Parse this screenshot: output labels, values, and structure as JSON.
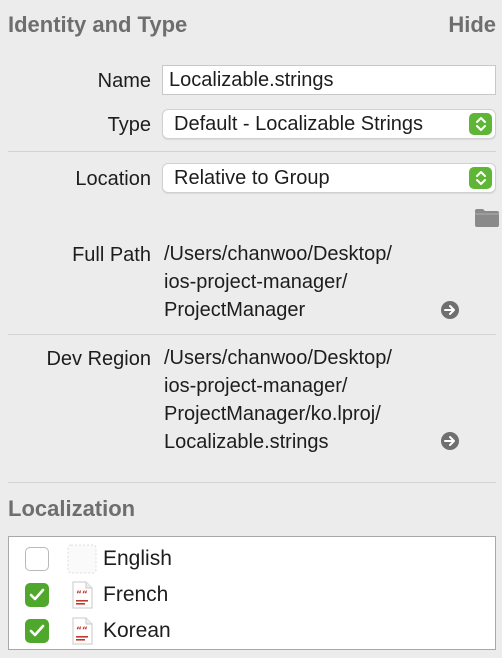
{
  "identity": {
    "title": "Identity and Type",
    "hide_label": "Hide",
    "name_label": "Name",
    "name_value": "Localizable.strings",
    "type_label": "Type",
    "type_value": "Default - Localizable Strings",
    "location_label": "Location",
    "location_value": "Relative to Group",
    "full_path_label": "Full Path",
    "full_path_lines": [
      "/Users/chanwoo/Desktop/",
      "ios-project-manager/",
      "ProjectManager"
    ],
    "dev_region_label": "Dev Region",
    "dev_region_lines": [
      "/Users/chanwoo/Desktop/",
      "ios-project-manager/",
      "ProjectManager/ko.lproj/",
      "Localizable.strings"
    ]
  },
  "localization": {
    "title": "Localization",
    "items": [
      {
        "label": "English",
        "checked": false
      },
      {
        "label": "French",
        "checked": true
      },
      {
        "label": "Korean",
        "checked": true
      }
    ]
  },
  "colors": {
    "accent_green": "#5fb536",
    "header_gray": "#6e6e6e",
    "panel_bg": "#ececec"
  },
  "icons": {
    "folder": "folder-icon",
    "reveal": "arrow-circle-right-icon",
    "stepper": "chevron-up-down-icon",
    "file": "strings-file-icon"
  }
}
